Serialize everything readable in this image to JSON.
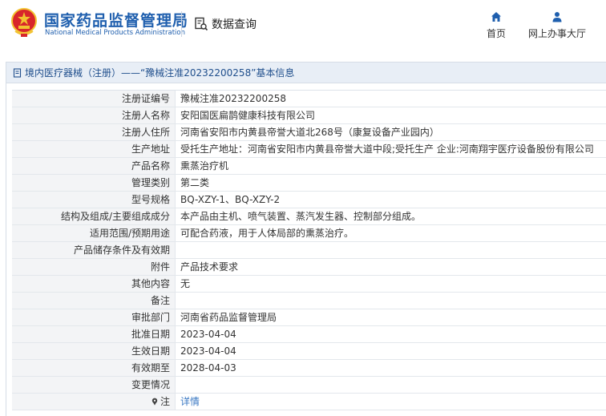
{
  "header": {
    "brand_cn": "国家药品监督管理局",
    "brand_en": "National Medical Products Administration",
    "query_label": "数据查询",
    "nav": [
      {
        "label": "首页",
        "icon": "home-icon"
      },
      {
        "label": "网上办事大厅",
        "icon": "user-icon"
      }
    ]
  },
  "page": {
    "title": "境内医疗器械（注册）——“豫械注准20232200258”基本信息"
  },
  "colors": {
    "brand": "#1f5fae",
    "emblem_red": "#d8262b",
    "emblem_gold": "#f2c230",
    "title_bar": "#e8eef6",
    "link": "#3a78c3"
  },
  "details": [
    {
      "label": "注册证编号",
      "value": "豫械注准20232200258"
    },
    {
      "label": "注册人名称",
      "value": "安阳国医扁鹊健康科技有限公司"
    },
    {
      "label": "注册人住所",
      "value": "河南省安阳市内黄县帝誉大道北268号（康复设备产业园内）"
    },
    {
      "label": "生产地址",
      "value": "受托生产地址：河南省安阳市内黄县帝誉大道中段;受托生产 企业:河南翔宇医疗设备股份有限公司"
    },
    {
      "label": "产品名称",
      "value": "熏蒸治疗机"
    },
    {
      "label": "管理类别",
      "value": "第二类"
    },
    {
      "label": "型号规格",
      "value": "BQ-XZY-1、BQ-XZY-2"
    },
    {
      "label": "结构及组成/主要组成成分",
      "value": "本产品由主机、喷气装置、蒸汽发生器、控制部分组成。"
    },
    {
      "label": "适用范围/预期用途",
      "value": "可配合药液，用于人体局部的熏蒸治疗。"
    },
    {
      "label": "产品储存条件及有效期",
      "value": ""
    },
    {
      "label": "附件",
      "value": "产品技术要求"
    },
    {
      "label": "其他内容",
      "value": "无"
    },
    {
      "label": "备注",
      "value": ""
    },
    {
      "label": "审批部门",
      "value": "河南省药品监督管理局"
    },
    {
      "label": "批准日期",
      "value": "2023-04-04"
    },
    {
      "label": "生效日期",
      "value": "2023-04-04"
    },
    {
      "label": "有效期至",
      "value": "2028-04-03"
    },
    {
      "label": "变更情况",
      "value": ""
    }
  ],
  "note_row": {
    "label": "注",
    "value": "详情",
    "icon": "pin-icon"
  }
}
